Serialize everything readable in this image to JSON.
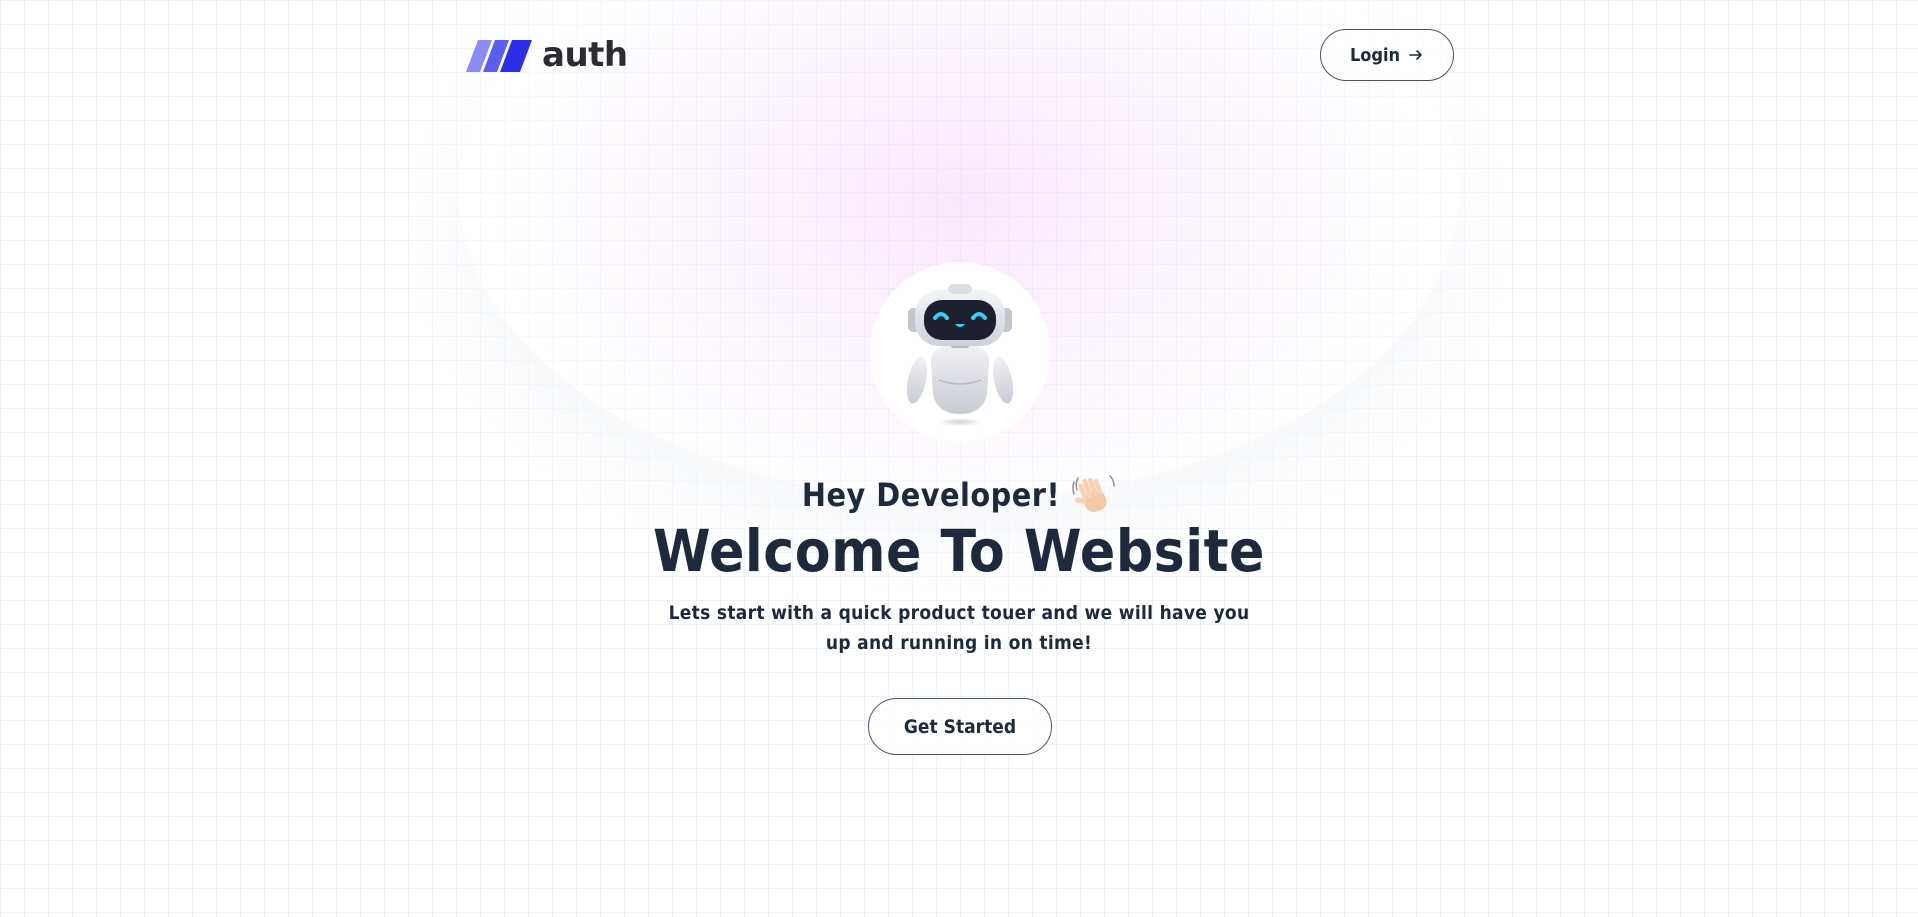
{
  "header": {
    "logo_text": "auth",
    "logo_icon": "three-slanted-bars-logo",
    "login_label": "Login",
    "login_icon": "arrow-right-icon"
  },
  "hero": {
    "avatar_icon": "robot-avatar",
    "greeting": "Hey Developer!",
    "greeting_icon": "waving-hand-icon",
    "headline": "Welcome To Website",
    "subtitle": "Lets start with a quick product touer and we will have you up and running in on time!",
    "cta_label": "Get Started"
  },
  "colors": {
    "logo_bar_light": "#8b8cf5",
    "logo_bar_mid": "#5b5ef0",
    "logo_bar_dark": "#2b2ee8",
    "text_dark": "#1e293b",
    "glow_pink": "#f4d2fa",
    "robot_face": "#2cd6f0"
  }
}
